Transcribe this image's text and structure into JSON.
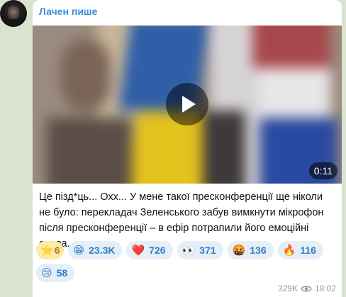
{
  "channel": {
    "name": "Лачен пише"
  },
  "video": {
    "duration": "0:11"
  },
  "message": {
    "text": "Це пізд*ць... Охх... У мене такої пресконференції ще ніколи не було: перекладач Зеленського забув вимкнути мікрофон після пресконференції – в ефір потрапили його емоційні слова."
  },
  "reactions": [
    {
      "emoji": "⭐",
      "count": "6",
      "kind": "paid"
    },
    {
      "emoji": "😁",
      "count": "23.3K"
    },
    {
      "emoji": "❤️",
      "count": "726"
    },
    {
      "emoji": "👀",
      "count": "371"
    },
    {
      "emoji": "🤬",
      "count": "136"
    },
    {
      "emoji": "🔥",
      "count": "116"
    },
    {
      "emoji": "😢",
      "count": "58"
    }
  ],
  "meta": {
    "views": "329K",
    "time": "18:02",
    "views_icon": "eye-icon"
  },
  "colors": {
    "sender": "#3a8ed6",
    "reaction_bg": "#e6eef8",
    "reaction_text": "#2f7fc7",
    "paid_bg": "#fdeaa8"
  }
}
